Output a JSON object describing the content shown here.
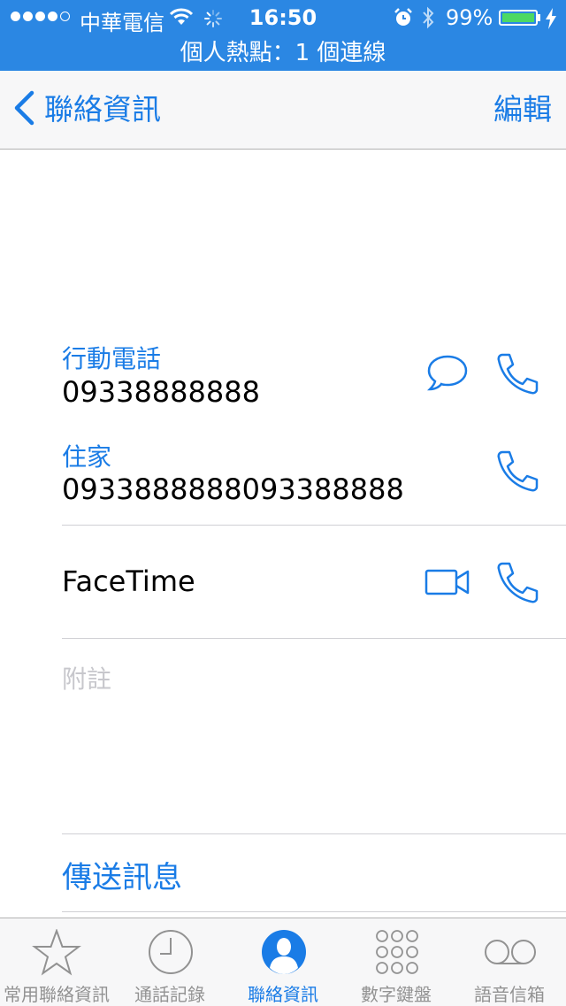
{
  "status_bar": {
    "carrier": "中華電信",
    "time": "16:50",
    "battery": "99%",
    "battery_level": 0.99,
    "hotspot": "個人熱點：1 個連線"
  },
  "nav": {
    "back_label": "聯絡資訊",
    "edit_label": "編輯"
  },
  "phones": [
    {
      "label": "行動電話",
      "number": "09338888888"
    },
    {
      "label": "住家",
      "number": "0933888888093388888"
    }
  ],
  "facetime": {
    "label": "FaceTime"
  },
  "notes": {
    "placeholder": "附註"
  },
  "actions": {
    "send_message": "傳送訊息"
  },
  "tabs": [
    {
      "label": "常用聯絡資訊",
      "icon": "star-icon"
    },
    {
      "label": "通話記錄",
      "icon": "clock-icon"
    },
    {
      "label": "聯絡資訊",
      "icon": "contacts-icon",
      "active": true
    },
    {
      "label": "數字鍵盤",
      "icon": "keypad-icon"
    },
    {
      "label": "語音信箱",
      "icon": "voicemail-icon"
    }
  ],
  "colors": {
    "accent": "#1a7ce6",
    "status_bar": "#2b87e3",
    "battery_fill": "#4cd964",
    "inactive_tab": "#929292"
  }
}
